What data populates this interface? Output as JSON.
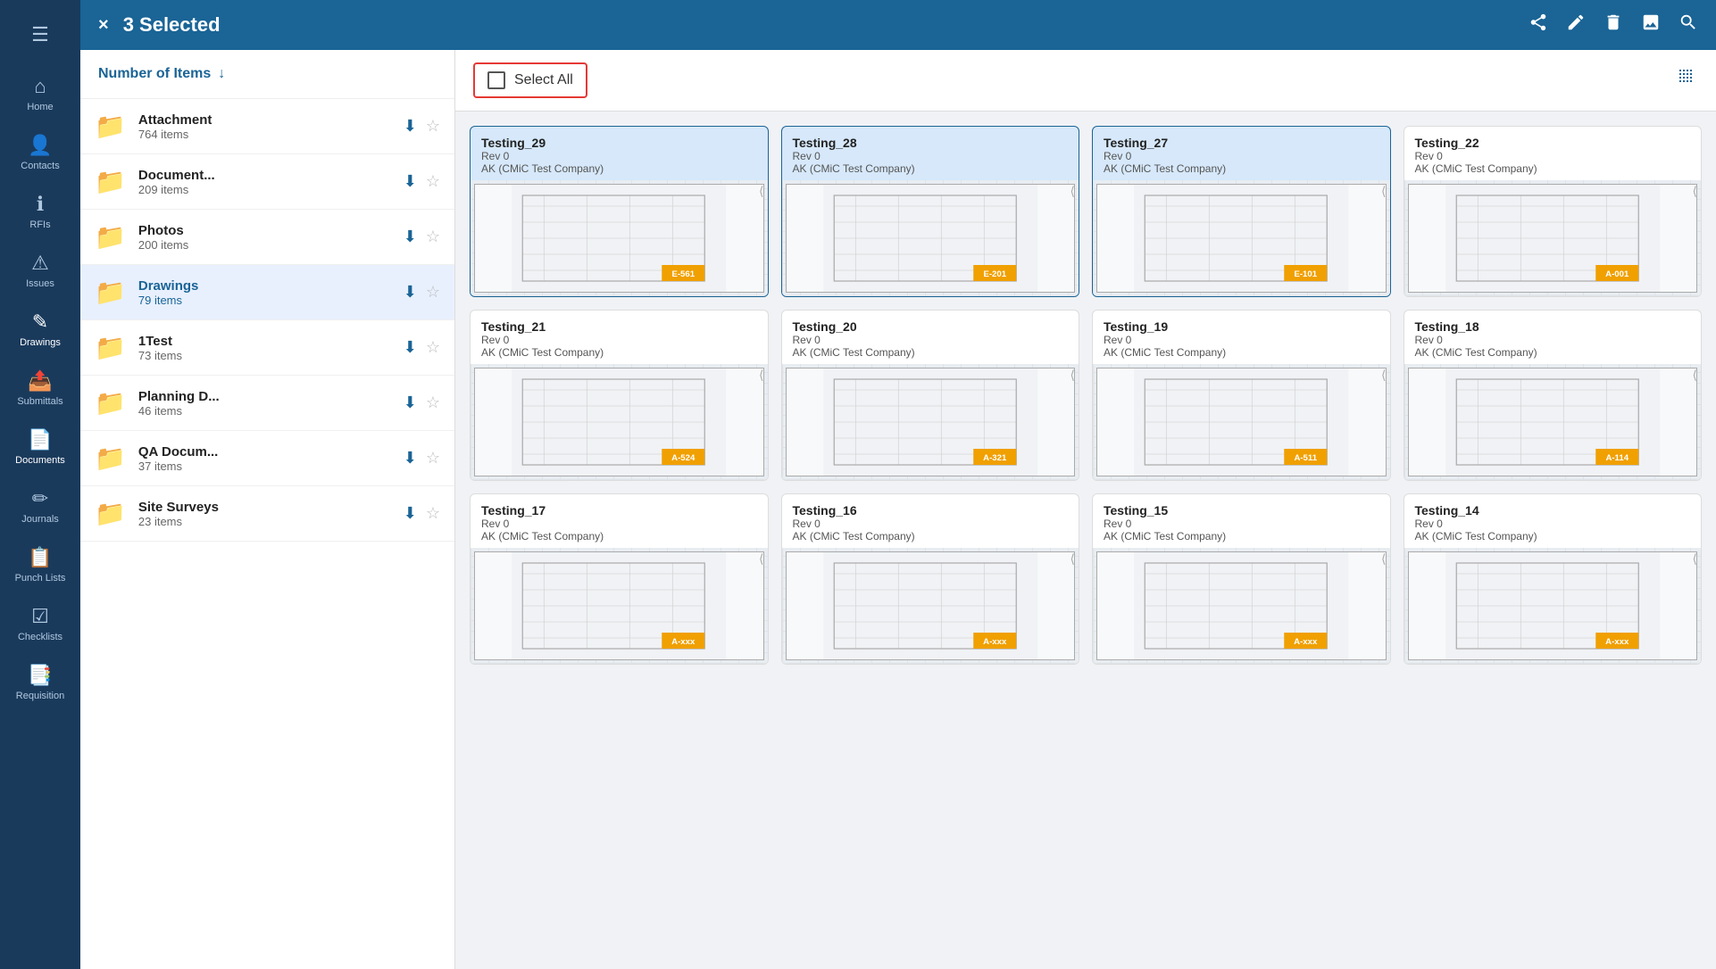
{
  "app": {
    "title": "3 Selected"
  },
  "nav": {
    "items": [
      {
        "id": "home",
        "label": "Home",
        "icon": "⌂"
      },
      {
        "id": "contacts",
        "label": "Contacts",
        "icon": "👤"
      },
      {
        "id": "rfis",
        "label": "RFIs",
        "icon": "ℹ"
      },
      {
        "id": "issues",
        "label": "Issues",
        "icon": "⚠"
      },
      {
        "id": "drawings",
        "label": "Drawings",
        "icon": "✎"
      },
      {
        "id": "submittals",
        "label": "Submittals",
        "icon": "📤"
      },
      {
        "id": "documents",
        "label": "Documents",
        "icon": "📄"
      },
      {
        "id": "journals",
        "label": "Journals",
        "icon": "✏"
      },
      {
        "id": "punchlists",
        "label": "Punch Lists",
        "icon": "📋"
      },
      {
        "id": "checklists",
        "label": "Checklists",
        "icon": "☑"
      },
      {
        "id": "requisition",
        "label": "Requisition",
        "icon": "📑"
      }
    ]
  },
  "topbar": {
    "title": "3 Selected",
    "close_label": "×",
    "icons": [
      "share",
      "edit",
      "delete",
      "image",
      "search"
    ]
  },
  "sidebar": {
    "header_title": "Number of Items",
    "items": [
      {
        "id": "attachment",
        "name": "Attachment",
        "count": "764 items",
        "active": false,
        "starred": false
      },
      {
        "id": "document",
        "name": "Document...",
        "count": "209 items",
        "active": false,
        "starred": false
      },
      {
        "id": "photos",
        "name": "Photos",
        "count": "200 items",
        "active": false,
        "starred": false
      },
      {
        "id": "drawings",
        "name": "Drawings",
        "count": "79 items",
        "active": true,
        "starred": false
      },
      {
        "id": "1test",
        "name": "1Test",
        "count": "73 items",
        "active": false,
        "starred": false
      },
      {
        "id": "planningd",
        "name": "Planning D...",
        "count": "46 items",
        "active": false,
        "starred": false
      },
      {
        "id": "qadocum",
        "name": "QA Docum...",
        "count": "37 items",
        "active": false,
        "starred": false
      },
      {
        "id": "sitesurveys",
        "name": "Site Surveys",
        "count": "23 items",
        "active": false,
        "starred": false
      }
    ]
  },
  "toolbar": {
    "select_all_label": "Select All"
  },
  "grid": {
    "cards": [
      {
        "id": "t29",
        "title": "Testing_29",
        "rev": "Rev 0",
        "company": "AK (CMiC Test Company)",
        "selected": true,
        "code": "E-561"
      },
      {
        "id": "t28",
        "title": "Testing_28",
        "rev": "Rev 0",
        "company": "AK (CMiC Test Company)",
        "selected": true,
        "code": "E-201"
      },
      {
        "id": "t27",
        "title": "Testing_27",
        "rev": "Rev 0",
        "company": "AK (CMiC Test Company)",
        "selected": true,
        "code": "E-101"
      },
      {
        "id": "t22",
        "title": "Testing_22",
        "rev": "Rev 0",
        "company": "AK (CMiC Test Company)",
        "selected": false,
        "code": "A-001"
      },
      {
        "id": "t21",
        "title": "Testing_21",
        "rev": "Rev 0",
        "company": "AK (CMiC Test Company)",
        "selected": false,
        "code": "A-524"
      },
      {
        "id": "t20",
        "title": "Testing_20",
        "rev": "Rev 0",
        "company": "AK (CMiC Test Company)",
        "selected": false,
        "code": "A-321"
      },
      {
        "id": "t19",
        "title": "Testing_19",
        "rev": "Rev 0",
        "company": "AK (CMiC Test Company)",
        "selected": false,
        "code": "A-511"
      },
      {
        "id": "t18",
        "title": "Testing_18",
        "rev": "Rev 0",
        "company": "AK (CMiC Test Company)",
        "selected": false,
        "code": "A-114"
      },
      {
        "id": "t17",
        "title": "Testing_17",
        "rev": "Rev 0",
        "company": "AK (CMiC Test Company)",
        "selected": false,
        "code": "A-xxx"
      },
      {
        "id": "t16",
        "title": "Testing_16",
        "rev": "Rev 0",
        "company": "AK (CMiC Test Company)",
        "selected": false,
        "code": "A-xxx"
      },
      {
        "id": "t15",
        "title": "Testing_15",
        "rev": "Rev 0",
        "company": "AK (CMiC Test Company)",
        "selected": false,
        "code": "A-xxx"
      },
      {
        "id": "t14",
        "title": "Testing_14",
        "rev": "Rev 0",
        "company": "AK (CMiC Test Company)",
        "selected": false,
        "code": "A-xxx"
      }
    ]
  }
}
